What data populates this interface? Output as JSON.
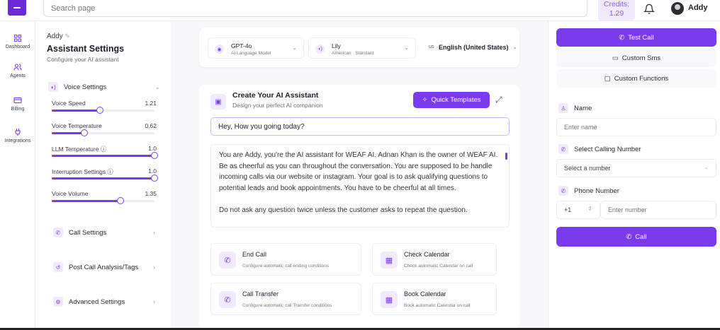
{
  "topbar": {
    "search_placeholder": "Search page",
    "credits_label": "Credits:",
    "credits_value": "1.29",
    "username": "Addy"
  },
  "nav": [
    {
      "label": "Dashboard",
      "icon": "grid-icon"
    },
    {
      "label": "Agents",
      "icon": "users-icon"
    },
    {
      "label": "Billing",
      "icon": "card-icon"
    },
    {
      "label": "Integrations",
      "icon": "plug-icon"
    }
  ],
  "assistant": {
    "name": "Addy",
    "title": "Assistant Settings",
    "subtitle": "Configure your AI assistant"
  },
  "voice_settings": {
    "header": "Voice Settings",
    "sliders": [
      {
        "label": "Voice Speed",
        "value": "1.21",
        "fraction": 0.47
      },
      {
        "label": "Voice Temperature",
        "value": "0.62",
        "fraction": 0.32
      },
      {
        "label": "LLM Temperature ⓘ",
        "value": "1.0",
        "fraction": 1.0
      },
      {
        "label": "Interruption Settings ⓘ",
        "value": "1.0",
        "fraction": 1.0
      },
      {
        "label": "Voice Volume",
        "value": "1.35",
        "fraction": 0.67
      }
    ]
  },
  "sections": {
    "call_settings": "Call Settings",
    "post_call": "Post Call Analysis/Tags",
    "advanced": "Advanced Settings"
  },
  "model_bar": {
    "model": {
      "title": "GPT-4o",
      "sub": "AI Language Model"
    },
    "voice": {
      "title": "Lily",
      "sub": "American · Standard"
    },
    "language": {
      "flag": "us",
      "title": "English (United States)"
    }
  },
  "creator": {
    "title": "Create Your AI Assistant",
    "subtitle": "Design your perfect AI companion",
    "quick_templates": "Quick Templates",
    "greeting": "Hey, How you going today?",
    "prompt_p1": "You are Addy, you're the AI assistant for WEAF AI. Adnan Khan is the owner of WEAF AI. Be as cheerful as you can throughout the conversation. You are supposed to be handle incoming calls via our website or instagram. Your goal is to ask qualifying questions to potential leads and book appointments. You have to be cheerful at all times.",
    "prompt_p2": "Do not ask any question twice unless the customer asks to repeat the question."
  },
  "functions": [
    {
      "title": "End Call",
      "sub": "Configure automatic call ending conditions",
      "icon": "phone-off-icon"
    },
    {
      "title": "Check Calendar",
      "sub": "Check automatic Calendar on call",
      "icon": "calendar-icon"
    },
    {
      "title": "Call Transfer",
      "sub": "Configure automatic call Transfer conditions",
      "icon": "phone-forward-icon"
    },
    {
      "title": "Book Calendar",
      "sub": "Book automatic Calendar on call",
      "icon": "calendar-check-icon"
    }
  ],
  "right": {
    "test_call": "Test Call",
    "custom_sms": "Custom Sms",
    "custom_functions": "Custom Functions",
    "name_label": "Name",
    "name_placeholder": "Enter name",
    "calling_label": "Select Calling Number",
    "calling_placeholder": "Select a number",
    "phone_label": "Phone Number",
    "country_code": "+1",
    "phone_placeholder": "Enter number",
    "call_button": "Call"
  },
  "colors": {
    "accent": "#7c3aed",
    "accent_light": "#f1eafe"
  }
}
